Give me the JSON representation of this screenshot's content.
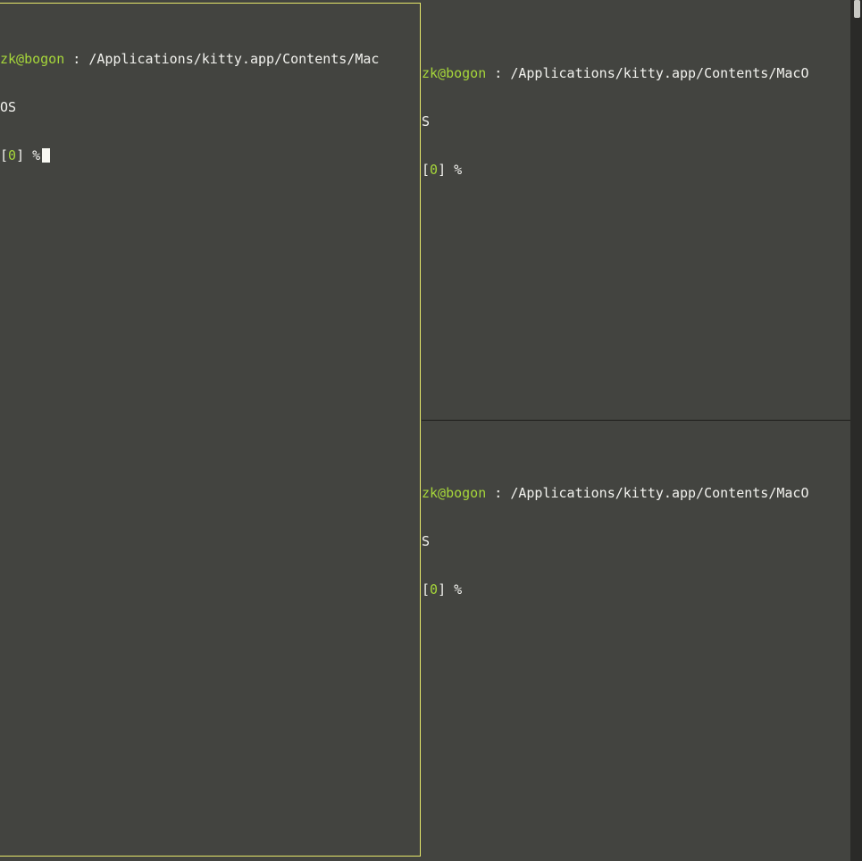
{
  "panes": {
    "left": {
      "user_host": "zk@bogon",
      "path_line1": " : /Applications/kitty.app/Contents/Mac",
      "path_line2": "OS",
      "bracket_open": "[",
      "exit_status": "0",
      "bracket_close": "]",
      "prompt": " %"
    },
    "right_top": {
      "user_host": "zk@bogon",
      "path_line1": " : /Applications/kitty.app/Contents/MacO",
      "path_line2": "S",
      "bracket_open": "[",
      "exit_status": "0",
      "bracket_close": "]",
      "prompt": " %"
    },
    "right_bottom": {
      "user_host": "zk@bogon",
      "path_line1": " : /Applications/kitty.app/Contents/MacO",
      "path_line2": "S",
      "bracket_open": "[",
      "exit_status": "0",
      "bracket_close": "]",
      "prompt": " %"
    }
  },
  "colors": {
    "background": "#434440",
    "foreground": "#f2f2ee",
    "user_host": "#a6d63a",
    "active_border": "#e6e86a",
    "divider": "#1d1d1b"
  }
}
